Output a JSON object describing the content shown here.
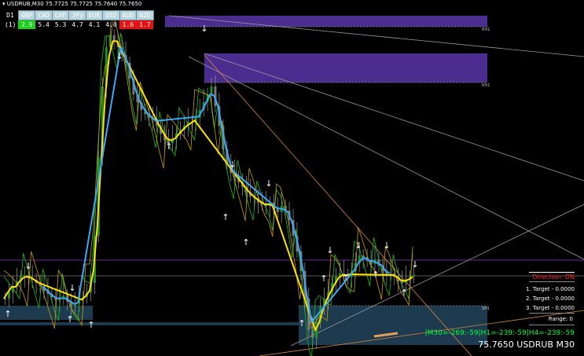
{
  "symbol_header": "USDRUB,M30  75.7725 75.7725 75.7640 75.7650",
  "strength_table": {
    "currencies": [
      "GBP",
      "CAD",
      "CHF",
      "JPy",
      "EUR",
      "USD",
      "AUD",
      "NZD"
    ],
    "rows": [
      {
        "tf": "D1",
        "values": []
      },
      {
        "tf": "(1)",
        "values": [
          "2.9",
          "5.4",
          "5.3",
          "4.7",
          "4.1",
          "4.0",
          "1.6",
          "1.7"
        ]
      }
    ],
    "highlight": {
      "green": [
        0
      ],
      "red": [
        6,
        7
      ]
    }
  },
  "panel": {
    "direction": "Direction: DN",
    "targets": [
      "1. Target - 0.0000",
      "2. Target - 0.0000",
      "3. Target - 0.0000"
    ],
    "range": "Range: 0",
    "mtf": "|M30=-269:-59|H1=-239:-59|H4=-239:-59",
    "price_label": "75.7650 USDRUB M30"
  },
  "zone_labels": {
    "rh_top": "RH1",
    "rh_mid": "RH1",
    "sh": "SH1"
  },
  "colors": {
    "bull_candle": "#1f8f2a",
    "bear_candle": "#7a7a7a",
    "yellow_line": "#ffe000",
    "blue_line": "#3aa8ff",
    "green_line": "#1dbb1d",
    "supply_zone": "#4b2c8f",
    "demand_zone": "#1d3a4f",
    "trend_orange": "#d8883a",
    "trend_gray": "#9a9a9a",
    "direction_red": "#ff2020",
    "mtf_green": "#00ff40"
  }
}
